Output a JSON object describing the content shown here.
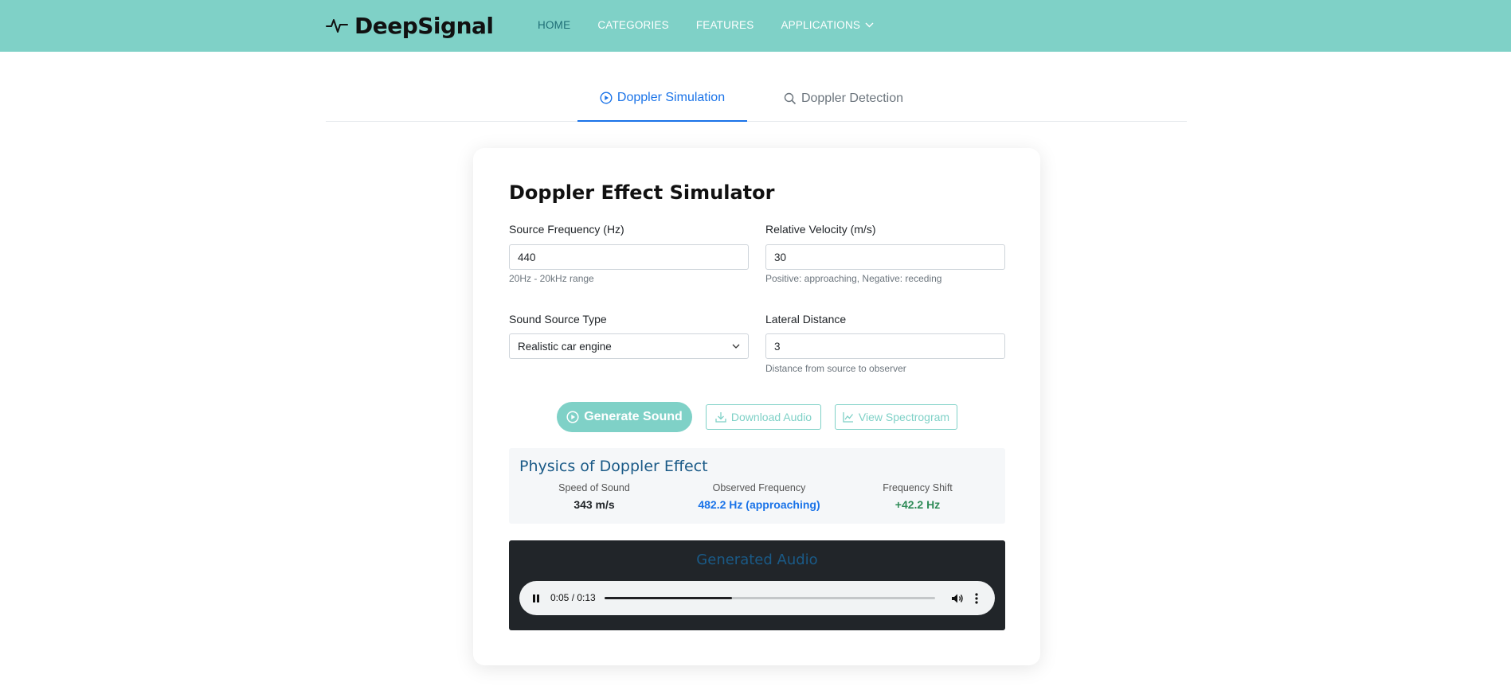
{
  "brand": {
    "name": "DeepSignal"
  },
  "nav": {
    "items": [
      {
        "label": "HOME"
      },
      {
        "label": "CATEGORIES"
      },
      {
        "label": "FEATURES"
      },
      {
        "label": "APPLICATIONS"
      }
    ]
  },
  "tabs": [
    {
      "label": "Doppler Simulation",
      "icon": "play-circle-icon",
      "active": true
    },
    {
      "label": "Doppler Detection",
      "icon": "search-icon",
      "active": false
    }
  ],
  "simulator": {
    "title": "Doppler Effect Simulator",
    "source_frequency": {
      "label": "Source Frequency (Hz)",
      "value": "440",
      "hint": "20Hz - 20kHz range"
    },
    "relative_velocity": {
      "label": "Relative Velocity (m/s)",
      "value": "30",
      "hint": "Positive: approaching, Negative: receding"
    },
    "sound_source_type": {
      "label": "Sound Source Type",
      "value": "Realistic car engine"
    },
    "lateral_distance": {
      "label": "Lateral Distance",
      "value": "3",
      "hint": "Distance from source to observer"
    },
    "buttons": {
      "generate": "Generate Sound",
      "download": "Download Audio",
      "spectrogram": "View Spectrogram"
    }
  },
  "physics": {
    "title": "Physics of Doppler Effect",
    "speed_of_sound": {
      "label": "Speed of Sound",
      "value": "343 m/s"
    },
    "observed_frequency": {
      "label": "Observed Frequency",
      "value": "482.2 Hz (approaching)"
    },
    "frequency_shift": {
      "label": "Frequency Shift",
      "value": "+42.2 Hz"
    }
  },
  "audio": {
    "title": "Generated Audio",
    "time": "0:05 / 0:13",
    "progress": 0.385
  },
  "colors": {
    "navbar": "#7fd1c7",
    "accent_blue": "#1a73e8",
    "shift_green": "#2e8b57",
    "physics_title": "#1a5a87"
  }
}
